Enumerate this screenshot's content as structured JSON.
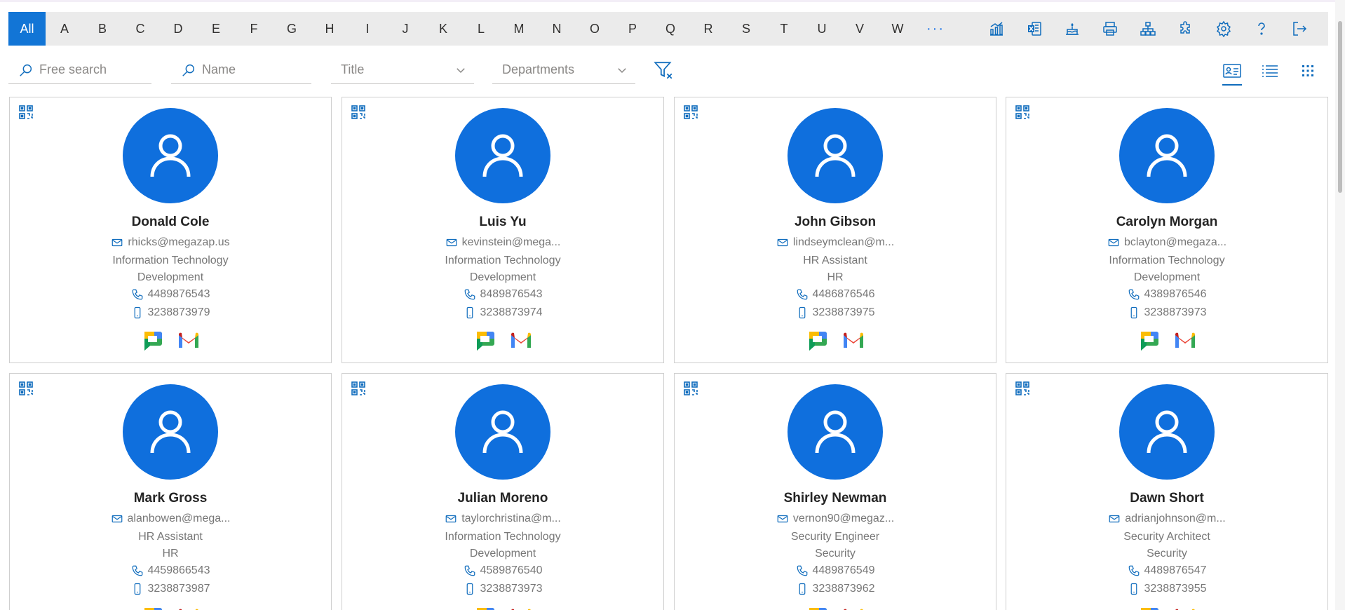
{
  "alphabet": {
    "letters": [
      "All",
      "A",
      "B",
      "C",
      "D",
      "E",
      "F",
      "G",
      "H",
      "I",
      "J",
      "K",
      "L",
      "M",
      "N",
      "O",
      "P",
      "Q",
      "R",
      "S",
      "T",
      "U",
      "V",
      "W"
    ],
    "active": "All",
    "more_label": "···"
  },
  "toolbar": {
    "icons": [
      "analytics-icon",
      "excel-export-icon",
      "birthday-icon",
      "print-icon",
      "org-chart-icon",
      "extensions-icon",
      "settings-icon",
      "help-icon",
      "sign-out-icon"
    ]
  },
  "filters": {
    "free_search_placeholder": "Free search",
    "name_placeholder": "Name",
    "title_placeholder": "Title",
    "departments_placeholder": "Departments"
  },
  "views": [
    "card-view-icon",
    "list-view-icon",
    "grid-view-icon"
  ],
  "colors": {
    "accent": "#0f6fdd",
    "toolbar_bg": "#ebebeb"
  },
  "people": [
    {
      "name": "Donald Cole",
      "email": "rhicks@megazap.us",
      "title": "Information Technology",
      "department": "Development",
      "phone": "4489876543",
      "mobile": "3238873979"
    },
    {
      "name": "Luis Yu",
      "email": "kevinstein@mega...",
      "title": "Information Technology",
      "department": "Development",
      "phone": "8489876543",
      "mobile": "3238873974"
    },
    {
      "name": "John Gibson",
      "email": "lindseymclean@m...",
      "title": "HR Assistant",
      "department": "HR",
      "phone": "4486876546",
      "mobile": "3238873975"
    },
    {
      "name": "Carolyn Morgan",
      "email": "bclayton@megaza...",
      "title": "Information Technology",
      "department": "Development",
      "phone": "4389876546",
      "mobile": "3238873973"
    },
    {
      "name": "Mark Gross",
      "email": "alanbowen@mega...",
      "title": "HR Assistant",
      "department": "HR",
      "phone": "4459866543",
      "mobile": "3238873987"
    },
    {
      "name": "Julian Moreno",
      "email": "taylorchristina@m...",
      "title": "Information Technology",
      "department": "Development",
      "phone": "4589876540",
      "mobile": "3238873973"
    },
    {
      "name": "Shirley Newman",
      "email": "vernon90@megaz...",
      "title": "Security Engineer",
      "department": "Security",
      "phone": "4489876549",
      "mobile": "3238873962"
    },
    {
      "name": "Dawn Short",
      "email": "adrianjohnson@m...",
      "title": "Security Architect",
      "department": "Security",
      "phone": "4489876547",
      "mobile": "3238873955"
    }
  ]
}
